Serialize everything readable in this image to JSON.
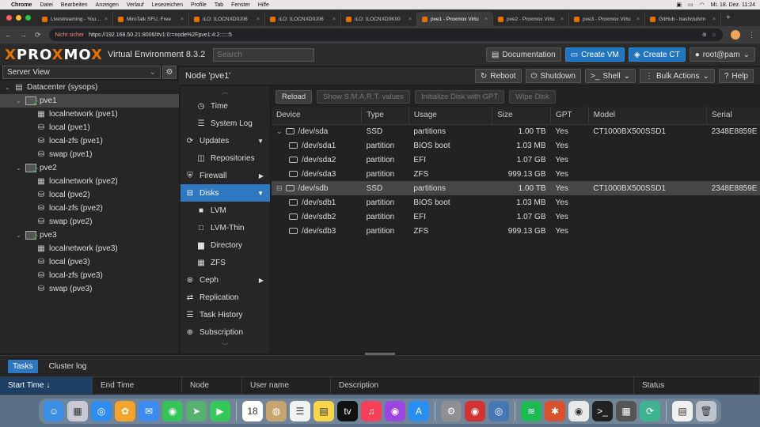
{
  "macbar": {
    "apple": "",
    "menus": [
      "Chrome",
      "Datei",
      "Bearbeiten",
      "Anzeigen",
      "Verlauf",
      "Lesezeichen",
      "Profile",
      "Tab",
      "Fenster",
      "Hilfe"
    ],
    "clock": "Mi. 18. Dez.  11:24"
  },
  "browser": {
    "tabs": [
      {
        "title": "Livestreaming - YouTube",
        "active": false
      },
      {
        "title": "MiroTalk SFU, Free",
        "active": false
      },
      {
        "title": "iLO: ILOCNXD0J06",
        "active": false
      },
      {
        "title": "iLO: ILOCNXD0J06",
        "active": false
      },
      {
        "title": "iLO: ILOCNXD0K00",
        "active": false
      },
      {
        "title": "pve1 - Proxmox Virtu",
        "active": true
      },
      {
        "title": "pve2 - Proxmox Virtu",
        "active": false
      },
      {
        "title": "pve3 - Proxmox Virtu",
        "active": false
      },
      {
        "title": "GitHub - bashclub/m",
        "active": false
      }
    ],
    "security": "Nicht sicher",
    "url": "https://192.168.50.21:8006/#v1:0:=node%2Fpve1:4:2::::::5"
  },
  "header": {
    "logo_a": "PRO",
    "logo_x": "X",
    "logo_b": "MO",
    "logo_x2": "X",
    "version": "Virtual Environment 8.3.2",
    "search_placeholder": "Search",
    "documentation": "Documentation",
    "create_vm": "Create VM",
    "create_ct": "Create CT",
    "user": "root@pam"
  },
  "sidebar": {
    "view": "Server View",
    "tree": [
      {
        "label": "Datacenter (sysops)",
        "depth": 0,
        "kind": "datacenter",
        "toggle": "⌄"
      },
      {
        "label": "pve1",
        "depth": 1,
        "kind": "node",
        "toggle": "⌄",
        "selected": true
      },
      {
        "label": "localnetwork (pve1)",
        "depth": 2,
        "kind": "network"
      },
      {
        "label": "local (pve1)",
        "depth": 2,
        "kind": "storage"
      },
      {
        "label": "local-zfs (pve1)",
        "depth": 2,
        "kind": "storage"
      },
      {
        "label": "swap (pve1)",
        "depth": 2,
        "kind": "storage"
      },
      {
        "label": "pve2",
        "depth": 1,
        "kind": "node",
        "toggle": "⌄"
      },
      {
        "label": "localnetwork (pve2)",
        "depth": 2,
        "kind": "network"
      },
      {
        "label": "local (pve2)",
        "depth": 2,
        "kind": "storage"
      },
      {
        "label": "local-zfs (pve2)",
        "depth": 2,
        "kind": "storage"
      },
      {
        "label": "swap (pve2)",
        "depth": 2,
        "kind": "storage"
      },
      {
        "label": "pve3",
        "depth": 1,
        "kind": "node",
        "toggle": "⌄"
      },
      {
        "label": "localnetwork (pve3)",
        "depth": 2,
        "kind": "network"
      },
      {
        "label": "local (pve3)",
        "depth": 2,
        "kind": "storage"
      },
      {
        "label": "local-zfs (pve3)",
        "depth": 2,
        "kind": "storage"
      },
      {
        "label": "swap (pve3)",
        "depth": 2,
        "kind": "storage-question"
      }
    ]
  },
  "node": {
    "title": "Node 'pve1'",
    "reboot": "Reboot",
    "shutdown": "Shutdown",
    "shell": "Shell",
    "bulk_actions": "Bulk Actions",
    "help": "Help"
  },
  "nav": [
    {
      "label": "Time",
      "icon": "clock-icon",
      "glyph": "◷",
      "sub": true
    },
    {
      "label": "System Log",
      "icon": "list-icon",
      "glyph": "☰",
      "sub": true
    },
    {
      "label": "Updates",
      "icon": "refresh-icon",
      "glyph": "⟳",
      "caret": "▼"
    },
    {
      "label": "Repositories",
      "icon": "box-icon",
      "glyph": "◫",
      "sub": true
    },
    {
      "label": "Firewall",
      "icon": "shield-icon",
      "glyph": "⛨",
      "caret": "▶"
    },
    {
      "label": "Disks",
      "icon": "disk-icon",
      "glyph": "⊟",
      "caret": "▼",
      "selected": true
    },
    {
      "label": "LVM",
      "icon": "square-icon",
      "glyph": "■",
      "sub": true
    },
    {
      "label": "LVM-Thin",
      "icon": "square-outline-icon",
      "glyph": "□",
      "sub": true
    },
    {
      "label": "Directory",
      "icon": "folder-icon",
      "glyph": "▆",
      "sub": true
    },
    {
      "label": "ZFS",
      "icon": "grid-icon",
      "glyph": "▦",
      "sub": true
    },
    {
      "label": "Ceph",
      "icon": "ceph-icon",
      "glyph": "⊛",
      "caret": "▶"
    },
    {
      "label": "Replication",
      "icon": "replication-icon",
      "glyph": "⇄"
    },
    {
      "label": "Task History",
      "icon": "list-icon",
      "glyph": "☰"
    },
    {
      "label": "Subscription",
      "icon": "support-icon",
      "glyph": "⊕"
    }
  ],
  "toolbar": {
    "reload": "Reload",
    "smart": "Show S.M.A.R.T. values",
    "init_gpt": "Initialize Disk with GPT",
    "wipe": "Wipe Disk"
  },
  "disks": {
    "columns": [
      "Device",
      "Type",
      "Usage",
      "Size",
      "GPT",
      "Model",
      "Serial"
    ],
    "rows": [
      {
        "device": "/dev/sda",
        "type": "SSD",
        "usage": "partitions",
        "size": "1.00 TB",
        "gpt": "Yes",
        "model": "CT1000BX500SSD1",
        "serial": "2348E8859E",
        "level": 0,
        "toggle": "⌄"
      },
      {
        "device": "/dev/sda1",
        "type": "partition",
        "usage": "BIOS boot",
        "size": "1.03 MB",
        "gpt": "Yes",
        "model": "",
        "serial": "",
        "level": 1
      },
      {
        "device": "/dev/sda2",
        "type": "partition",
        "usage": "EFI",
        "size": "1.07 GB",
        "gpt": "Yes",
        "model": "",
        "serial": "",
        "level": 1
      },
      {
        "device": "/dev/sda3",
        "type": "partition",
        "usage": "ZFS",
        "size": "999.13 GB",
        "gpt": "Yes",
        "model": "",
        "serial": "",
        "level": 1
      },
      {
        "device": "/dev/sdb",
        "type": "SSD",
        "usage": "partitions",
        "size": "1.00 TB",
        "gpt": "Yes",
        "model": "CT1000BX500SSD1",
        "serial": "2348E8859E",
        "level": 0,
        "toggle": "⊟",
        "highlight": true
      },
      {
        "device": "/dev/sdb1",
        "type": "partition",
        "usage": "BIOS boot",
        "size": "1.03 MB",
        "gpt": "Yes",
        "model": "",
        "serial": "",
        "level": 1
      },
      {
        "device": "/dev/sdb2",
        "type": "partition",
        "usage": "EFI",
        "size": "1.07 GB",
        "gpt": "Yes",
        "model": "",
        "serial": "",
        "level": 1
      },
      {
        "device": "/dev/sdb3",
        "type": "partition",
        "usage": "ZFS",
        "size": "999.13 GB",
        "gpt": "Yes",
        "model": "",
        "serial": "",
        "level": 1
      }
    ]
  },
  "tasks": {
    "tab_tasks": "Tasks",
    "tab_cluster": "Cluster log",
    "columns": [
      "Start Time ↓",
      "End Time",
      "Node",
      "User name",
      "Description",
      "Status"
    ]
  },
  "dock": {
    "apps": [
      {
        "name": "finder-icon",
        "color": "#3a8ee6",
        "glyph": "☺"
      },
      {
        "name": "launchpad-icon",
        "color": "#c9c9d6",
        "glyph": "▦"
      },
      {
        "name": "safari-icon",
        "color": "#2f8cf0",
        "glyph": "◎"
      },
      {
        "name": "photos-icon",
        "color": "#f4a42c",
        "glyph": "✿"
      },
      {
        "name": "mail-icon",
        "color": "#3b8bf1",
        "glyph": "✉"
      },
      {
        "name": "messages-icon",
        "color": "#36c35a",
        "glyph": "◉"
      },
      {
        "name": "maps-icon",
        "color": "#55b16d",
        "glyph": "➤"
      },
      {
        "name": "facetime-icon",
        "color": "#34c759",
        "glyph": "▶"
      },
      {
        "name": "calendar-icon",
        "color": "#ffffff",
        "glyph": "18"
      },
      {
        "name": "contacts-icon",
        "color": "#c8a46e",
        "glyph": "◍"
      },
      {
        "name": "reminders-icon",
        "color": "#f2f2f2",
        "glyph": "☰"
      },
      {
        "name": "notes-icon",
        "color": "#f7d64a",
        "glyph": "▤"
      },
      {
        "name": "tv-icon",
        "color": "#111111",
        "glyph": "tv"
      },
      {
        "name": "music-icon",
        "color": "#f5405a",
        "glyph": "♫"
      },
      {
        "name": "podcasts-icon",
        "color": "#9b46e0",
        "glyph": "◉"
      },
      {
        "name": "appstore-icon",
        "color": "#2a8df2",
        "glyph": "A"
      },
      {
        "name": "settings-icon",
        "color": "#8e8e93",
        "glyph": "⚙"
      },
      {
        "name": "app-red-icon",
        "color": "#d33333",
        "glyph": "◉"
      },
      {
        "name": "app-blue-icon",
        "color": "#4577b5",
        "glyph": "◎"
      },
      {
        "name": "spotify-icon",
        "color": "#1db954",
        "glyph": "≋"
      },
      {
        "name": "app-orange-icon",
        "color": "#d8522d",
        "glyph": "✱"
      },
      {
        "name": "chrome-icon",
        "color": "#e8e8e8",
        "glyph": "◉"
      },
      {
        "name": "terminal-icon",
        "color": "#222222",
        "glyph": ">_"
      },
      {
        "name": "calculator-icon",
        "color": "#555555",
        "glyph": "▦"
      },
      {
        "name": "app-green-icon",
        "color": "#3fb28f",
        "glyph": "⟳"
      },
      {
        "name": "document-icon",
        "color": "#f0f0f0",
        "glyph": "▤"
      },
      {
        "name": "trash-icon",
        "color": "#bfc5cc",
        "glyph": "🗑"
      }
    ]
  }
}
